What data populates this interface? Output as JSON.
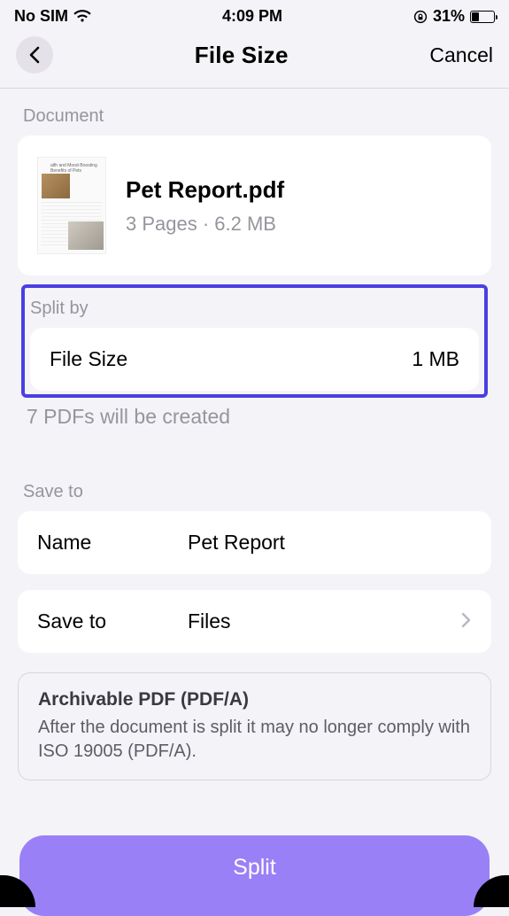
{
  "status": {
    "carrier": "No SIM",
    "time": "4:09 PM",
    "battery_pct": "31%"
  },
  "nav": {
    "title": "File Size",
    "cancel": "Cancel"
  },
  "document": {
    "section_label": "Document",
    "filename": "Pet Report.pdf",
    "meta": "3 Pages  ·  6.2 MB"
  },
  "split": {
    "section_label": "Split by",
    "mode": "File Size",
    "value": "1 MB",
    "hint": "7 PDFs will be created"
  },
  "save": {
    "section_label": "Save to",
    "name_label": "Name",
    "name_value": "Pet Report",
    "saveto_label": "Save to",
    "saveto_value": "Files"
  },
  "notice": {
    "title": "Archivable PDF (PDF/A)",
    "body": "After the document is split it may no longer comply with ISO 19005 (PDF/A)."
  },
  "action": {
    "split": "Split"
  }
}
